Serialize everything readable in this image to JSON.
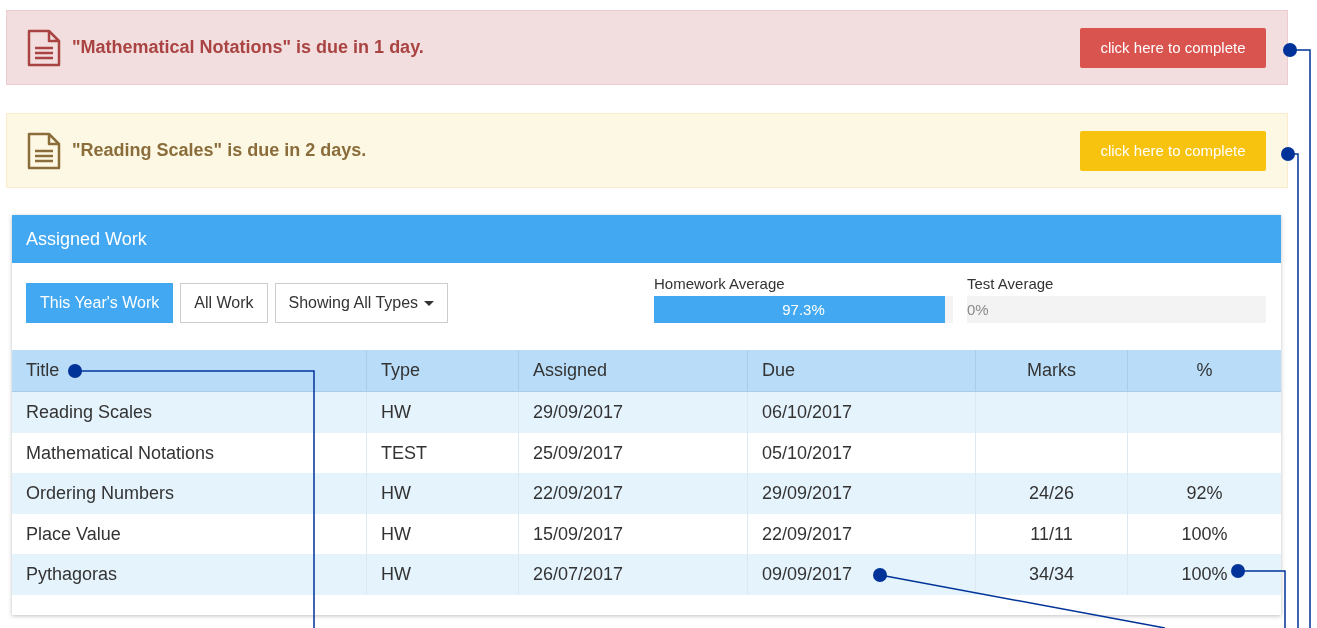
{
  "alerts": [
    {
      "kind": "danger",
      "message": "\"Mathematical Notations\" is due in 1 day.",
      "button": "click here to complete"
    },
    {
      "kind": "warning",
      "message": "\"Reading Scales\" is due in 2 days.",
      "button": "click here to complete"
    }
  ],
  "panel": {
    "title": "Assigned Work",
    "filters": [
      {
        "label": "This Year's Work",
        "selected": true
      },
      {
        "label": "All Work",
        "selected": false
      }
    ],
    "type_dropdown": "Showing All Types",
    "averages": [
      {
        "label": "Homework Average",
        "level": 0.973,
        "reading": "97.3%"
      },
      {
        "label": "Test Average",
        "level": 0,
        "reading": "0%"
      }
    ],
    "table": {
      "columns": [
        "Title",
        "Type",
        "Assigned",
        "Due",
        "Marks",
        "%"
      ],
      "rows": [
        [
          "Reading Scales",
          "HW",
          "29/09/2017",
          "06/10/2017",
          "",
          ""
        ],
        [
          "Mathematical Notations",
          "TEST",
          "25/09/2017",
          "05/10/2017",
          "",
          ""
        ],
        [
          "Ordering Numbers",
          "HW",
          "22/09/2017",
          "29/09/2017",
          "24/26",
          "92%"
        ],
        [
          "Place Value",
          "HW",
          "15/09/2017",
          "22/09/2017",
          "11/11",
          "100%"
        ],
        [
          "Pythagoras",
          "HW",
          "26/07/2017",
          "09/09/2017",
          "34/34",
          "100%"
        ]
      ]
    }
  }
}
